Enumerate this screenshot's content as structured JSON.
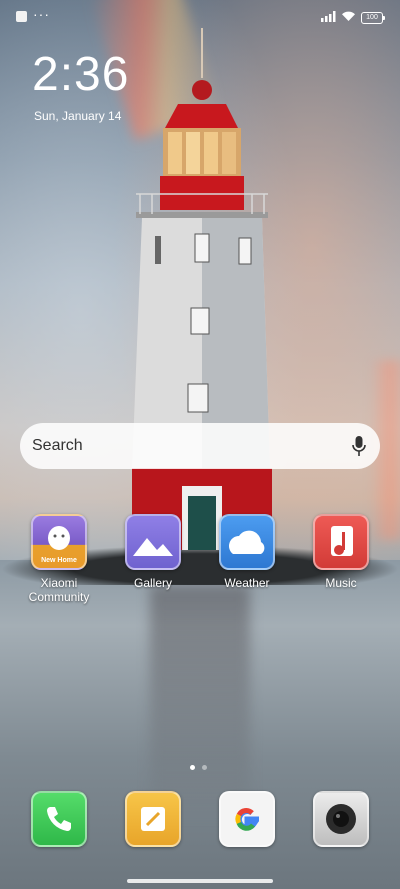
{
  "status_bar": {
    "dots": "···",
    "battery": "100"
  },
  "lockscreen": {
    "time": "2:36",
    "date": "Sun, January 14"
  },
  "search": {
    "placeholder": "Search"
  },
  "apps": [
    {
      "label": "Xiaomi Community",
      "icon": "xiaomi-community-icon",
      "color": "#e89a2c",
      "sublabel": "New Home"
    },
    {
      "label": "Gallery",
      "icon": "gallery-icon",
      "color": "#8b7be0"
    },
    {
      "label": "Weather",
      "icon": "weather-icon",
      "color": "#3f8fe6"
    },
    {
      "label": "Music",
      "icon": "music-icon",
      "color": "#e24a45"
    }
  ],
  "dock": [
    {
      "icon": "phone-icon",
      "color": "#3fcf5a"
    },
    {
      "icon": "notes-icon",
      "color": "#f2b634"
    },
    {
      "icon": "google-icon",
      "color": "#ffffff"
    },
    {
      "icon": "camera-icon",
      "color": "#2b2b2b"
    }
  ],
  "page_indicator": {
    "pages": 2,
    "current": 1
  }
}
